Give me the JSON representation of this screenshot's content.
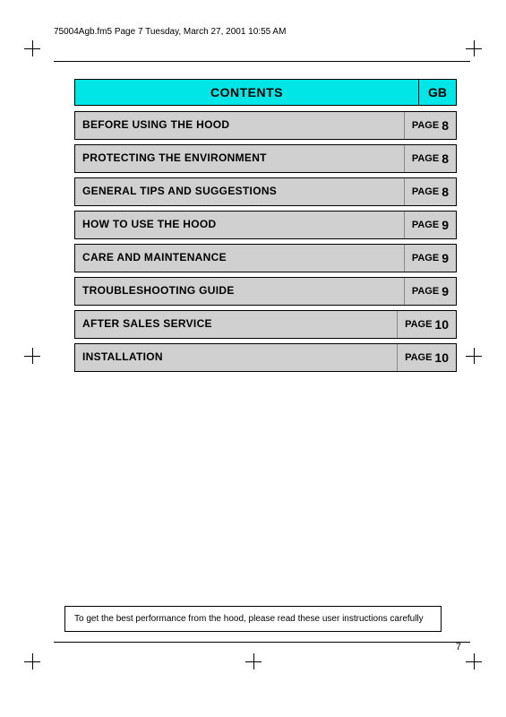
{
  "header": {
    "text": "75004Agb.fm5  Page 7  Tuesday, March 27, 2001  10:55 AM"
  },
  "contents": {
    "title": "CONTENTS",
    "gb_label": "GB"
  },
  "toc": {
    "items": [
      {
        "label": "BEFORE USING THE HOOD",
        "page_label": "PAGE",
        "page_num": "8"
      },
      {
        "label": "PROTECTING THE ENVIRONMENT",
        "page_label": "PAGE",
        "page_num": "8"
      },
      {
        "label": "GENERAL TIPS AND SUGGESTIONS",
        "page_label": "PAGE",
        "page_num": "8"
      },
      {
        "label": "HOW TO USE THE HOOD",
        "page_label": "PAGE",
        "page_num": "9"
      },
      {
        "label": "CARE AND MAINTENANCE",
        "page_label": "PAGE",
        "page_num": "9"
      },
      {
        "label": "TROUBLESHOOTING GUIDE",
        "page_label": "PAGE",
        "page_num": "9"
      },
      {
        "label": "AFTER SALES SERVICE",
        "page_label": "PAGE",
        "page_num": "10"
      },
      {
        "label": "INSTALLATION",
        "page_label": "PAGE",
        "page_num": "10"
      }
    ]
  },
  "footer": {
    "note": "To get the best performance from the hood, please read these user instructions carefully"
  },
  "page_number": "7"
}
